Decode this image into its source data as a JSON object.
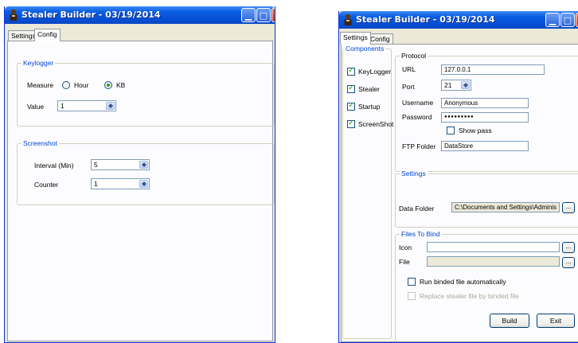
{
  "left_window": {
    "title": "Stealer Builder - 03/19/2014",
    "tabs": [
      "Settings",
      "Config"
    ],
    "keylogger": {
      "group_title": "Keylogger",
      "measure_label": "Measure",
      "option_hour": "Hour",
      "option_kb": "KB",
      "selected": "KB",
      "value_label": "Value",
      "value": "1"
    },
    "screenshot": {
      "group_title": "Screenshot",
      "interval_label": "Interval (Min)",
      "interval_value": "5",
      "counter_label": "Counter",
      "counter_value": "1"
    }
  },
  "right_window": {
    "title": "Stealer Builder - 03/19/2014",
    "tabs": [
      "Settings",
      "Config"
    ],
    "components": {
      "group_title": "Components",
      "items": [
        {
          "label": "KeyLogger",
          "checked": true
        },
        {
          "label": "Stealer",
          "checked": true
        },
        {
          "label": "Startup",
          "checked": true
        },
        {
          "label": "ScreenShot",
          "checked": true
        }
      ]
    },
    "protocol": {
      "group_title": "Protocol",
      "url_label": "URL",
      "url_value": "127.0.0.1",
      "port_label": "Port",
      "port_value": "21",
      "username_label": "Username",
      "username_value": "Anonymous",
      "password_label": "Password",
      "password_value": "●●●●●●●●●",
      "show_pass_label": "Show pass",
      "ftp_folder_label": "FTP Folder",
      "ftp_folder_value": "DataStore"
    },
    "settings": {
      "group_title": "Settings",
      "data_folder_label": "Data Folder",
      "data_folder_value": "C:\\Documents and Settings\\Adminis",
      "browse_label": "..."
    },
    "files_to_bind": {
      "group_title": "Files To Bind",
      "icon_label": "Icon",
      "file_label": "File",
      "browse_label": "...",
      "run_binded_label": "Run binded file automatically",
      "replace_label": "Replace stealer file by binded file"
    },
    "build_label": "Build",
    "exit_label": "Exit"
  },
  "colors": {
    "titlebar": "#0550d6",
    "group_title": "#0046d5",
    "window_border": "#0831d9"
  }
}
